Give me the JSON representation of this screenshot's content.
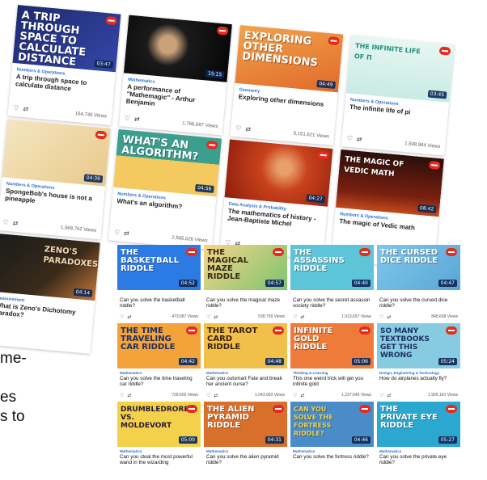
{
  "collage": {
    "cards": [
      {
        "thumb": "A trip through space to calculate distance",
        "category": "Numbers & Operations",
        "title": "A trip through space to calculate distance",
        "views": "154,746 Views",
        "duration": "03:47"
      },
      {
        "thumb": "",
        "category": "Mathematics",
        "title": "A performance of \"Mathemagic\" - Arthur Benjamin",
        "views": "1,766,687 Views",
        "duration": "15:15"
      },
      {
        "thumb": "Exploring other dimensions",
        "category": "Geometry",
        "title": "Exploring other dimensions",
        "views": "5,151,621 Views",
        "duration": "04:49"
      },
      {
        "thumb": "The infinite life of π",
        "category": "Numbers & Operations",
        "title": "The infinite life of pi",
        "views": "1,508,964 Views",
        "duration": "03:45"
      },
      {
        "thumb": "",
        "category": "Numbers & Operations",
        "title": "SpongeBob's house is not a pineapple",
        "views": "1,568,762 Views",
        "duration": "04:39"
      },
      {
        "thumb": "What's an algorithm?",
        "category": "Numbers & Operations",
        "title": "What's an algorithm?",
        "views": "2,565,026 Views",
        "duration": "04:56"
      },
      {
        "thumb": "",
        "category": "Data Analysis & Probability",
        "title": "The mathematics of history - Jean-Baptiste Michel",
        "views": "",
        "duration": "04:27"
      },
      {
        "thumb": "The magic of Vedic math",
        "category": "Numbers & Operations",
        "title": "The magic of Vedic math",
        "views": "",
        "duration": "08:42"
      },
      {
        "thumb": "Zeno's paradoxes",
        "category": "Measurement",
        "title": "What is Zeno's Dichotomy Paradox?",
        "views": "",
        "duration": "04:14"
      }
    ]
  },
  "grid": {
    "cards": [
      {
        "thumb": "The basketball riddle",
        "category": "",
        "title": "Can you solve the basketball riddle?",
        "views": "473,587 Views",
        "duration": "04:52"
      },
      {
        "thumb": "The magical maze riddle",
        "category": "",
        "title": "Can you solve the magical maze riddle?",
        "views": "538,759 Views",
        "duration": "04:57"
      },
      {
        "thumb": "The assassins riddle",
        "category": "",
        "title": "Can you solve the secret assassin society riddle?",
        "views": "1,913,657 Views",
        "duration": "04:40"
      },
      {
        "thumb": "The cursed dice riddle",
        "category": "",
        "title": "Can you solve the cursed dice riddle?",
        "views": "848,608 Views",
        "duration": "04:47"
      },
      {
        "thumb": "The time traveling car riddle",
        "category": "Mathematics",
        "title": "Can you solve the time traveling car riddle?",
        "views": "728,655 Views",
        "duration": "04:42"
      },
      {
        "thumb": "The tarot card riddle",
        "category": "Mathematics",
        "title": "Can you outsmart Fate and break her ancient curse?",
        "views": "1,043,093 Views",
        "duration": "04:48"
      },
      {
        "thumb": "Infinite gold riddle",
        "category": "Thinking & Learning",
        "title": "This one weird trick will get you infinite gold",
        "views": "1,237,645 Views",
        "duration": "05:06"
      },
      {
        "thumb": "So many textbooks get this wrong",
        "category": "Design, Engineering & Technology",
        "title": "How do airplanes actually fly?",
        "views": "1,926,181 Views",
        "duration": "05:24"
      },
      {
        "thumb": "Drumbledrore vs. Moldevort",
        "category": "Mathematics",
        "title": "Can you steal the most powerful wand in the wizarding",
        "views": "",
        "duration": "05:00"
      },
      {
        "thumb": "The alien pyramid riddle",
        "category": "Mathematics",
        "title": "Can you solve the alien pyramid riddle?",
        "views": "",
        "duration": "04:31"
      },
      {
        "thumb": "Can you solve the fortress riddle?",
        "category": "Mathematics",
        "title": "Can you solve the fortress riddle?",
        "views": "",
        "duration": "04:46"
      },
      {
        "thumb": "The private eye riddle",
        "category": "Mathematics",
        "title": "Can you solve the private eye riddle?",
        "views": "",
        "duration": "05:27"
      }
    ]
  },
  "slide_text": [
    "me-",
    "",
    "es",
    "s to"
  ],
  "icons": {
    "heart": "heart-icon",
    "share": "share-icon",
    "badge": "ted-ed-badge-icon"
  },
  "colors": {
    "accent_blue": "#2a6fd6",
    "badge_red": "#e62b1e"
  }
}
